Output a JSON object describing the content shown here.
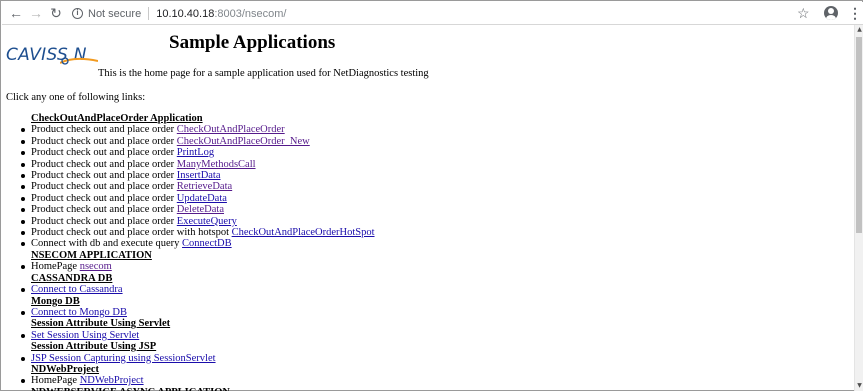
{
  "browser": {
    "back_icon": "←",
    "forward_icon": "→",
    "reload_icon": "↻",
    "security_icon": "i",
    "security_label": "Not secure",
    "url_host": "10.10.40.18",
    "url_rest": ":8003/nsecom/",
    "bookmark_icon": "☆",
    "menu_icon": "⋮"
  },
  "page": {
    "logo_text": "CAVISS N",
    "title": "Sample Applications",
    "subtitle": "This is the home page for a sample application used for NetDiagnostics testing",
    "intro": "Click any one of following links:",
    "items": [
      {
        "type": "header",
        "text": "CheckOutAndPlaceOrder Application"
      },
      {
        "type": "item",
        "prefix": "Product check out and place order ",
        "link": "CheckOutAndPlaceOrder",
        "visited": true
      },
      {
        "type": "item",
        "prefix": "Product check out and place order ",
        "link": "CheckOutAndPlaceOrder_New",
        "visited": true
      },
      {
        "type": "item",
        "prefix": "Product check out and place order ",
        "link": "PrintLog",
        "visited": false
      },
      {
        "type": "item",
        "prefix": "Product check out and place order ",
        "link": "ManyMethodsCall",
        "visited": true
      },
      {
        "type": "item",
        "prefix": "Product check out and place order ",
        "link": "InsertData",
        "visited": false
      },
      {
        "type": "item",
        "prefix": "Product check out and place order ",
        "link": "RetrieveData",
        "visited": true
      },
      {
        "type": "item",
        "prefix": "Product check out and place order ",
        "link": "UpdateData",
        "visited": false
      },
      {
        "type": "item",
        "prefix": "Product check out and place order ",
        "link": "DeleteData",
        "visited": true
      },
      {
        "type": "item",
        "prefix": "Product check out and place order ",
        "link": "ExecuteQuery",
        "visited": false
      },
      {
        "type": "item",
        "prefix": "Product check out and place order with hotspot ",
        "link": "CheckOutAndPlaceOrderHotSpot",
        "visited": false
      },
      {
        "type": "item",
        "prefix": "Connect with db and execute query ",
        "link": "ConnectDB",
        "visited": false
      },
      {
        "type": "header",
        "text": "NSECOM APPLICATION"
      },
      {
        "type": "item",
        "prefix": "HomePage ",
        "link": "nsecom",
        "visited": true
      },
      {
        "type": "header",
        "text": "CASSANDRA DB"
      },
      {
        "type": "item",
        "prefix": "",
        "link": "Connect to Cassandra",
        "visited": false
      },
      {
        "type": "header",
        "text": "Mongo DB"
      },
      {
        "type": "item",
        "prefix": "",
        "link": "Connect to Mongo DB",
        "visited": false
      },
      {
        "type": "header",
        "text": "Session Attribute Using Servlet"
      },
      {
        "type": "item",
        "prefix": "",
        "link": "Set Session Using Servlet",
        "visited": false
      },
      {
        "type": "header",
        "text": "Session Attribute Using JSP"
      },
      {
        "type": "item",
        "prefix": "",
        "link": "JSP Session Capturing using SessionServlet ",
        "visited": false
      },
      {
        "type": "header",
        "text": "NDWebProject"
      },
      {
        "type": "item",
        "prefix": "HomePage ",
        "link": "NDWebProject",
        "visited": false
      },
      {
        "type": "header",
        "text": "NDWEBSERVICE ASYNC APPLICATION"
      }
    ]
  },
  "colors": {
    "link": "#1a0dab",
    "visited_link": "#551a8b",
    "logo_blue": "#1d4e8f",
    "logo_orange": "#f29a1f"
  }
}
